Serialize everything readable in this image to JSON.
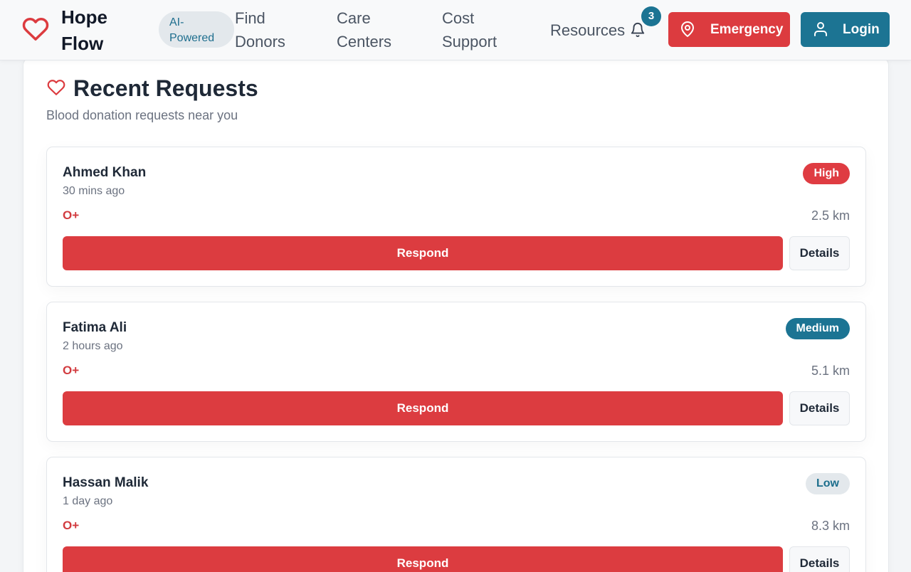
{
  "header": {
    "brand_line1": "Hope",
    "brand_line2": "Flow",
    "ai_badge_line1": "AI-",
    "ai_badge_line2": "Powered",
    "nav": {
      "find_donors_1": "Find",
      "find_donors_2": "Donors",
      "care_centers_1": "Care",
      "care_centers_2": "Centers",
      "cost_support_1": "Cost",
      "cost_support_2": "Support",
      "resources": "Resources"
    },
    "notification_count": "3",
    "emergency_label": "Emergency",
    "login_label": "Login"
  },
  "main": {
    "title": "Recent Requests",
    "subtitle": "Blood donation requests near you",
    "requests": [
      {
        "name": "Ahmed Khan",
        "time": "30 mins ago",
        "urgency": "High",
        "blood_type": "O+",
        "distance": "2.5 km",
        "respond_label": "Respond",
        "details_label": "Details"
      },
      {
        "name": "Fatima Ali",
        "time": "2 hours ago",
        "urgency": "Medium",
        "blood_type": "O+",
        "distance": "5.1 km",
        "respond_label": "Respond",
        "details_label": "Details"
      },
      {
        "name": "Hassan Malik",
        "time": "1 day ago",
        "urgency": "Low",
        "blood_type": "O+",
        "distance": "8.3 km",
        "respond_label": "Respond",
        "details_label": "Details"
      }
    ]
  },
  "colors": {
    "primary_red": "#dc3b3f",
    "primary_teal": "#1c7493",
    "muted_text": "#6b7280",
    "low_badge_bg": "#e3e8ec"
  },
  "icons": {
    "logo": "heart-icon",
    "notifications": "bell-icon",
    "emergency": "map-pin-icon",
    "login": "user-icon"
  }
}
